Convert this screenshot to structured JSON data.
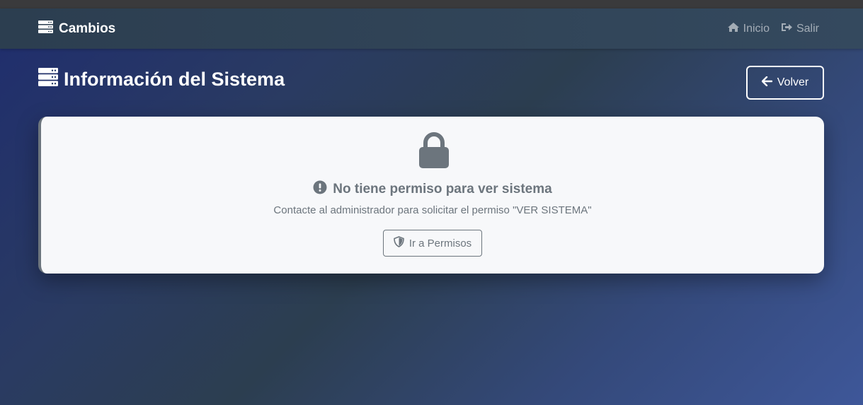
{
  "navbar": {
    "brand": "Cambios",
    "brand_icon": "server-icon",
    "links": [
      {
        "label": "Inicio",
        "icon": "home-icon"
      },
      {
        "label": "Salir",
        "icon": "sign-out-icon"
      }
    ]
  },
  "page": {
    "title": "Información del Sistema",
    "title_icon": "server-icon",
    "back_label": "Volver"
  },
  "alert": {
    "icon": "lock-icon",
    "title": "No tiene permiso para ver sistema",
    "message": "Contacte al administrador para solicitar el permiso \"VER SISTEMA\"",
    "button_label": "Ir a Permisos"
  },
  "colors": {
    "navbar": "#2c3e50",
    "muted": "#6c757d",
    "card": "#f7f8fa",
    "background_start": "#1f2d6e",
    "background_end": "#3e5799"
  }
}
